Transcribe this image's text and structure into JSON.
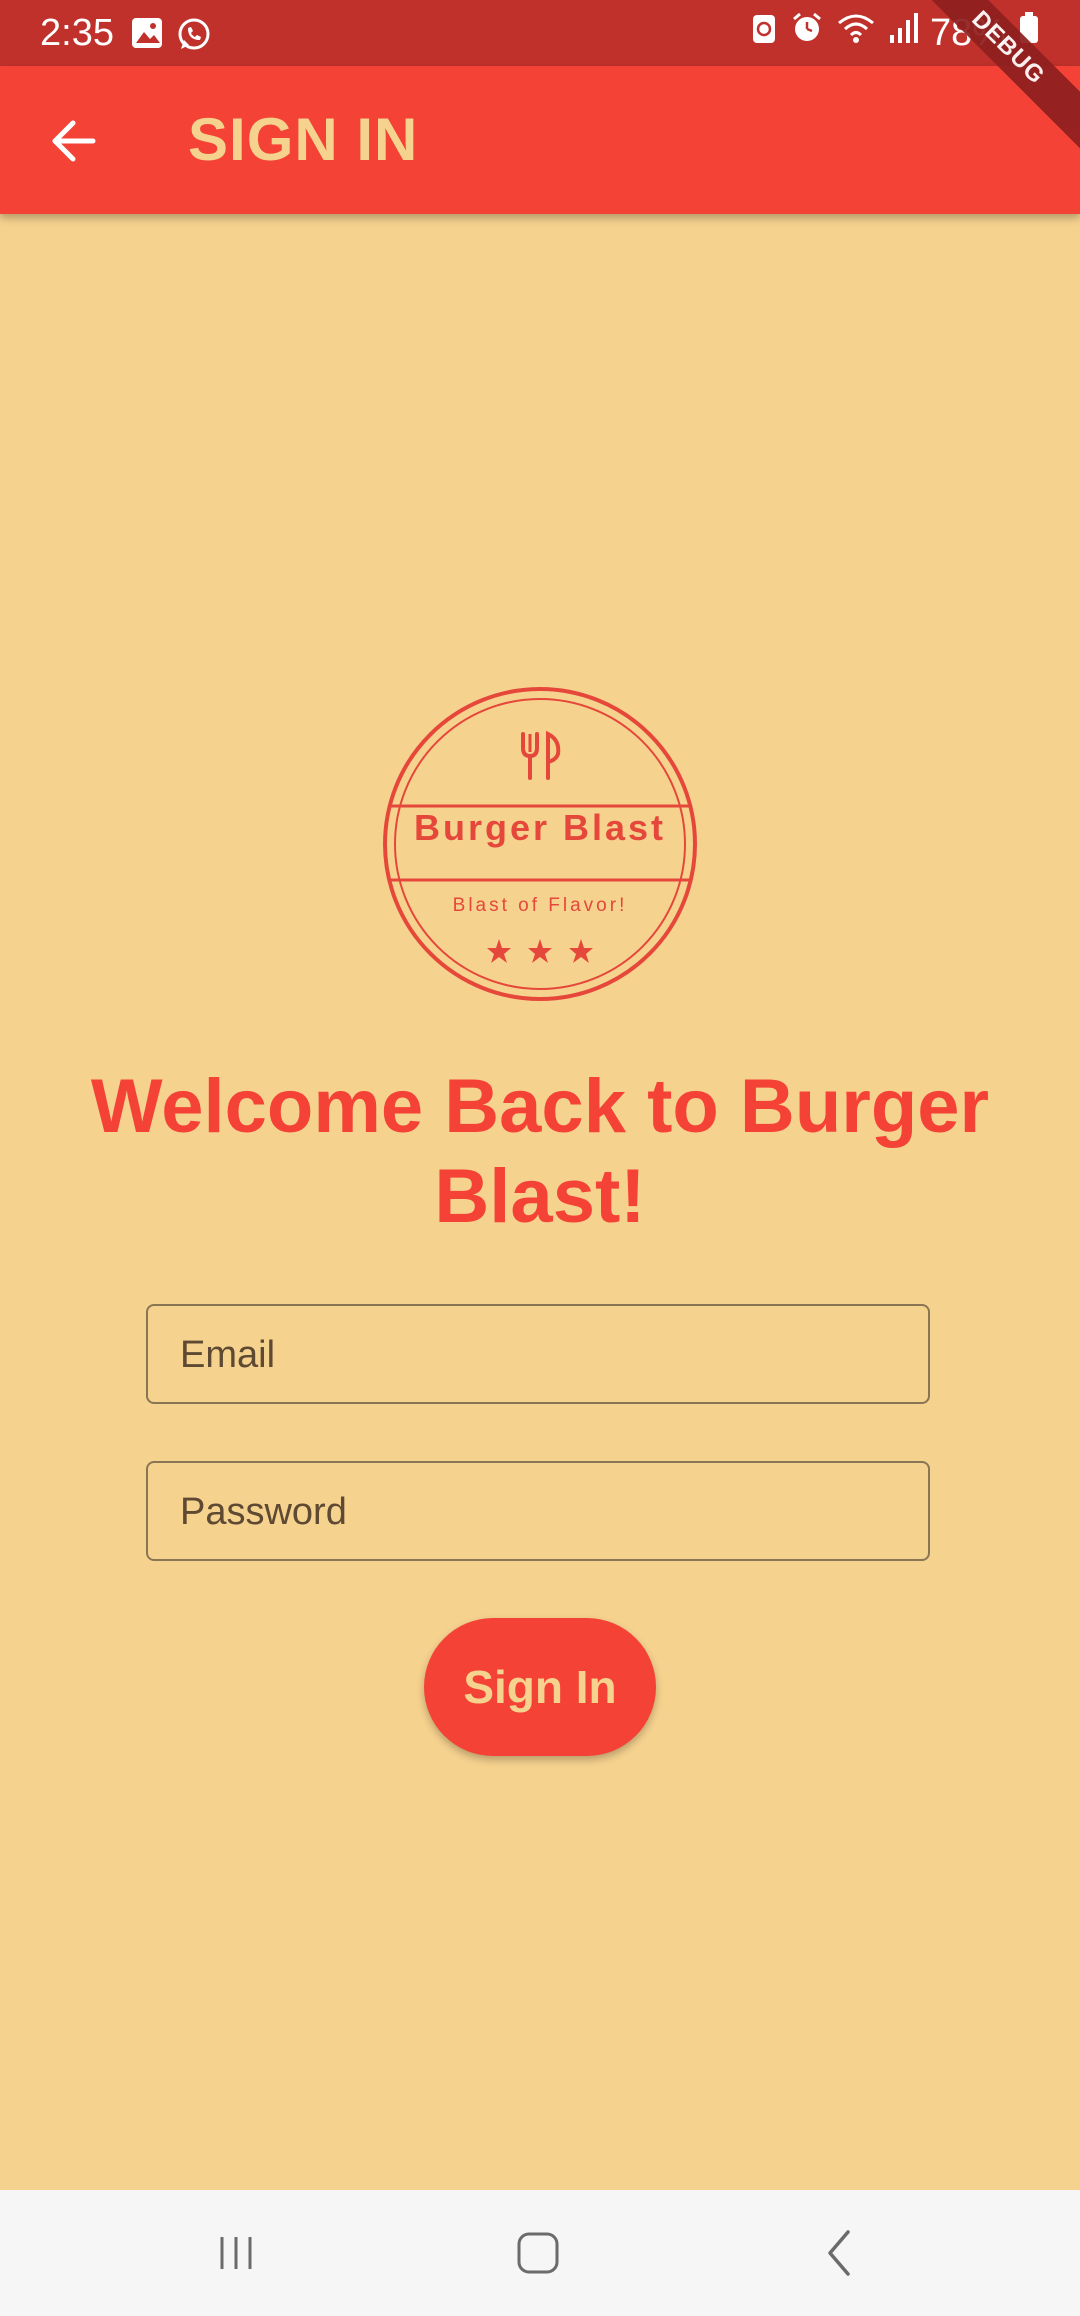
{
  "status_bar": {
    "time": "2:35",
    "battery": "78%",
    "debug_label": "DEBUG"
  },
  "app_bar": {
    "title": "SIGN IN"
  },
  "logo": {
    "brand": "Burger Blast",
    "tagline": "Blast of Flavor!"
  },
  "welcome": {
    "title": "Welcome Back to Burger Blast!"
  },
  "form": {
    "email_placeholder": "Email",
    "password_placeholder": "Password",
    "submit_label": "Sign In"
  },
  "colors": {
    "primary": "#f44336",
    "status_bar": "#c0312b",
    "background": "#f6d28f",
    "accent_text": "#f6d28f"
  },
  "icons": {
    "back": "arrow-left-icon",
    "nav_recents": "recents-icon",
    "nav_home": "home-icon",
    "nav_back": "chevron-left-icon"
  }
}
